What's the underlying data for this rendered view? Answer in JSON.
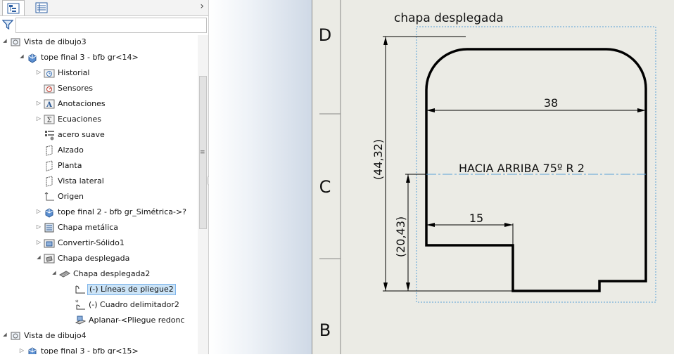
{
  "tree": {
    "filter_placeholder": "",
    "items": [
      {
        "label": "Vista de dibujo3",
        "icon": "drawing-view-icon",
        "arrow": "down"
      },
      {
        "label": "tope final 3 - bfb gr<14>",
        "icon": "part-icon",
        "arrow": "down"
      },
      {
        "label": "Historial",
        "icon": "history-folder-icon",
        "arrow": "right"
      },
      {
        "label": "Sensores",
        "icon": "sensors-folder-icon",
        "arrow": ""
      },
      {
        "label": "Anotaciones",
        "icon": "annotations-folder-icon",
        "arrow": "right"
      },
      {
        "label": "Ecuaciones",
        "icon": "equations-folder-icon",
        "arrow": "right"
      },
      {
        "label": "acero suave",
        "icon": "material-icon",
        "arrow": ""
      },
      {
        "label": "Alzado",
        "icon": "plane-icon",
        "arrow": ""
      },
      {
        "label": "Planta",
        "icon": "plane-icon",
        "arrow": ""
      },
      {
        "label": "Vista lateral",
        "icon": "plane-icon",
        "arrow": ""
      },
      {
        "label": "Origen",
        "icon": "origin-icon",
        "arrow": ""
      },
      {
        "label": "tope final 2 - bfb gr_Simétrica->?",
        "icon": "part-icon",
        "arrow": "right"
      },
      {
        "label": "Chapa metálica",
        "icon": "sheet-metal-icon",
        "arrow": "right"
      },
      {
        "label": "Convertir-Sólido1",
        "icon": "convert-solid-icon",
        "arrow": "right"
      },
      {
        "label": "Chapa desplegada",
        "icon": "flat-pattern-folder-icon",
        "arrow": "down"
      },
      {
        "label": "Chapa desplegada2",
        "icon": "flat-pattern-icon",
        "arrow": "down"
      },
      {
        "label": "(-) Líneas de pliegue2",
        "icon": "bend-lines-icon",
        "arrow": "",
        "selected": true
      },
      {
        "label": "(-) Cuadro delimitador2",
        "icon": "bounding-box-icon",
        "arrow": ""
      },
      {
        "label": "Aplanar-<Pliegue redonc",
        "icon": "flatten-icon",
        "arrow": ""
      },
      {
        "label": "Vista de dibujo4",
        "icon": "drawing-view-icon",
        "arrow": "down"
      },
      {
        "label": "tope final 3 - bfb gr<15>",
        "icon": "part-icon",
        "arrow": "right"
      }
    ]
  },
  "sheet": {
    "zone_labels": [
      "D",
      "C",
      "B"
    ],
    "view_title": "chapa desplegada",
    "dimensions": {
      "width_top": "38",
      "width_tab": "15",
      "height_total": "(44,32)",
      "height_partial": "(20,43)"
    },
    "bend_note": "HACIA ARRIBA  75º  R 2"
  },
  "colors": {
    "selection": "#cce4f7",
    "sheet_bg": "#ebebe5",
    "dashed_box": "#5aa0d8"
  }
}
